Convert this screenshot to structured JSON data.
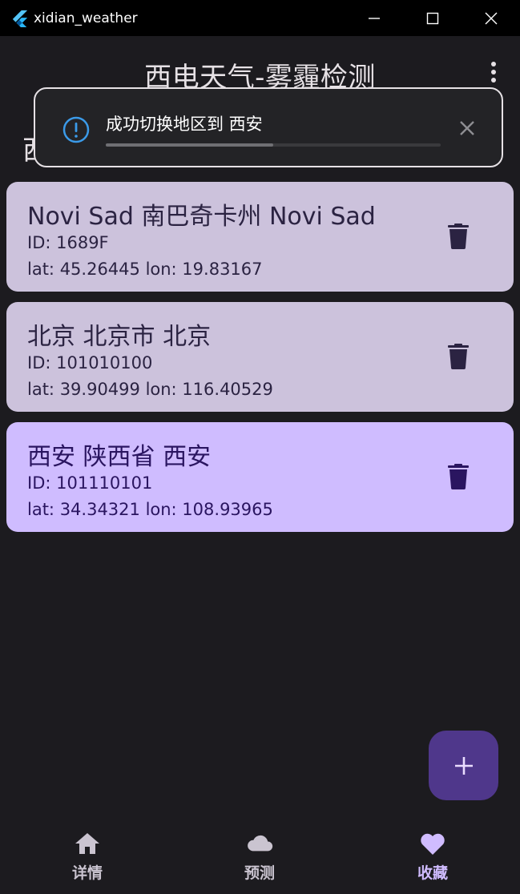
{
  "window": {
    "title": "xidian_weather"
  },
  "appbar": {
    "title": "西电天气-雾霾检测"
  },
  "header": {
    "location_partial": "西安"
  },
  "toast": {
    "message": "成功切换地区到 西安",
    "progress": 0.5
  },
  "favorites": [
    {
      "name": "Novi Sad 南巴奇卡州 Novi Sad",
      "id": "ID: 1689F",
      "coords": "lat: 45.26445 lon: 19.83167",
      "selected": false
    },
    {
      "name": "北京 北京市 北京",
      "id": "ID: 101010100",
      "coords": "lat: 39.90499 lon: 116.40529",
      "selected": false
    },
    {
      "name": "西安 陕西省 西安",
      "id": "ID: 101110101",
      "coords": "lat: 34.34321 lon: 108.93965",
      "selected": true
    }
  ],
  "fab": {
    "icon": "plus-icon"
  },
  "bottom_nav": {
    "items": [
      {
        "label": "详情",
        "icon": "home-icon",
        "active": false
      },
      {
        "label": "预测",
        "icon": "cloud-icon",
        "active": false
      },
      {
        "label": "收藏",
        "icon": "heart-icon",
        "active": true
      }
    ]
  },
  "colors": {
    "background": "#1c1b1f",
    "card": "#ccc2dc",
    "card_selected": "#cfbcff",
    "accent": "#4f378b",
    "info_icon": "#3b9ae8"
  }
}
